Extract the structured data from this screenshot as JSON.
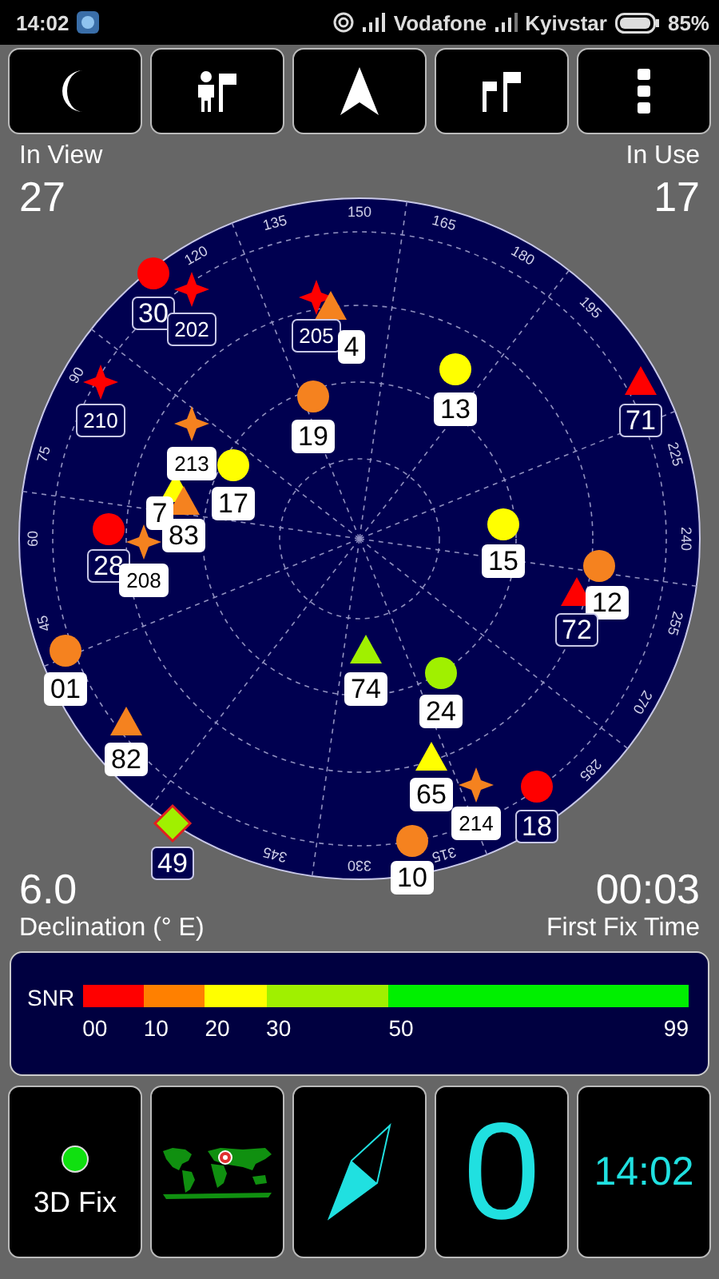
{
  "status_bar": {
    "time": "14:02",
    "carrier_1": "Vodafone",
    "carrier_2": "Kyivstar",
    "battery": "85%"
  },
  "stats": {
    "in_view_label": "In View",
    "in_view": "27",
    "in_use_label": "In Use",
    "in_use": "17",
    "declination": "6.0",
    "declination_label": "Declination (° E)",
    "first_fix": "00:03",
    "first_fix_label": "First Fix Time"
  },
  "sky_plot": {
    "azimuth_labels": [
      "135",
      "150",
      "165",
      "180",
      "195",
      "225",
      "240",
      "255",
      "270",
      "285",
      "315",
      "330",
      "345",
      "45",
      "60",
      "75",
      "90",
      "120"
    ],
    "satellites": [
      {
        "label": "30",
        "kind": "circle",
        "color": "#ff0000",
        "used": false
      },
      {
        "label": "202",
        "kind": "star",
        "color": "#ff0000",
        "used": false
      },
      {
        "label": "205",
        "kind": "star",
        "color": "#ff0000",
        "used": false
      },
      {
        "label": "4",
        "kind": "triangle",
        "color": "#f5821f",
        "used": true
      },
      {
        "label": "19",
        "kind": "circle",
        "color": "#f5821f",
        "used": true
      },
      {
        "label": "13",
        "kind": "circle",
        "color": "#ffff00",
        "used": true
      },
      {
        "label": "210",
        "kind": "star",
        "color": "#ff0000",
        "used": false
      },
      {
        "label": "71",
        "kind": "triangle",
        "color": "#ff0000",
        "used": false
      },
      {
        "label": "213",
        "kind": "star",
        "color": "#f5821f",
        "used": true
      },
      {
        "label": "17",
        "kind": "circle",
        "color": "#ffff00",
        "used": true
      },
      {
        "label": "7",
        "kind": "triangle",
        "color": "#ffff00",
        "used": true
      },
      {
        "label": "83",
        "kind": "triangle",
        "color": "#f5821f",
        "used": true
      },
      {
        "label": "28",
        "kind": "circle",
        "color": "#ff0000",
        "used": false
      },
      {
        "label": "208",
        "kind": "star",
        "color": "#f5821f",
        "used": true
      },
      {
        "label": "15",
        "kind": "circle",
        "color": "#ffff00",
        "used": true
      },
      {
        "label": "12",
        "kind": "circle",
        "color": "#f5821f",
        "used": true
      },
      {
        "label": "72",
        "kind": "triangle",
        "color": "#ff0000",
        "used": false
      },
      {
        "label": "01",
        "kind": "circle",
        "color": "#f5821f",
        "used": true
      },
      {
        "label": "74",
        "kind": "triangle",
        "color": "#a0f000",
        "used": true
      },
      {
        "label": "24",
        "kind": "circle",
        "color": "#a0f000",
        "used": true
      },
      {
        "label": "82",
        "kind": "triangle",
        "color": "#f5821f",
        "used": true
      },
      {
        "label": "65",
        "kind": "triangle",
        "color": "#ffff00",
        "used": true
      },
      {
        "label": "214",
        "kind": "star",
        "color": "#f5821f",
        "used": true
      },
      {
        "label": "18",
        "kind": "circle",
        "color": "#ff0000",
        "used": false
      },
      {
        "label": "49",
        "kind": "diamond",
        "color": "#a0f000",
        "used": false
      },
      {
        "label": "10",
        "kind": "circle",
        "color": "#f5821f",
        "used": true
      }
    ]
  },
  "snr": {
    "label": "SNR",
    "segments": [
      {
        "start": "00",
        "color": "#ff0000"
      },
      {
        "start": "10",
        "color": "#ff8000"
      },
      {
        "start": "20",
        "color": "#ffff00"
      },
      {
        "start": "30",
        "color": "#a0f000"
      },
      {
        "start": "50",
        "color": "#00f000"
      }
    ],
    "end": "99"
  },
  "tiles": {
    "fix": "3D Fix",
    "count": "0",
    "clock": "14:02"
  }
}
